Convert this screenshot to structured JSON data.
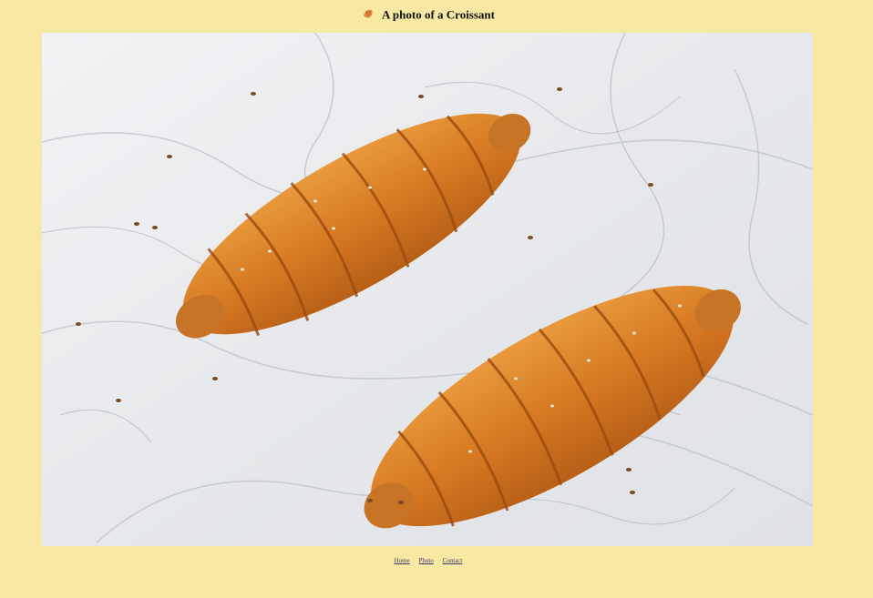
{
  "header": {
    "icon": "croissant-icon",
    "title": "A photo of a Croissant"
  },
  "photo": {
    "subject": "two croissants with seeds on white marble"
  },
  "nav": {
    "links": [
      "Home",
      "Photo",
      "Contact"
    ]
  },
  "colors": {
    "page_background": "#f7e8a3",
    "croissant": "#d27a24",
    "marble": "#e9ebee"
  }
}
